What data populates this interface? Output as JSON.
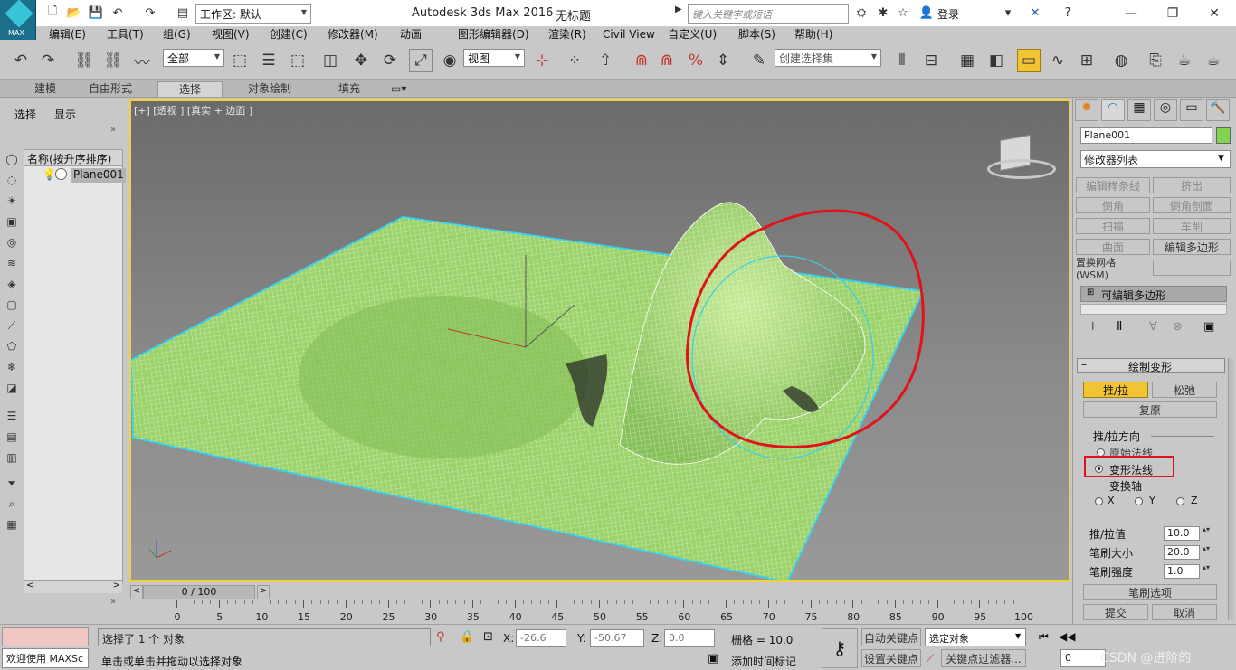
{
  "app": {
    "title": "Autodesk 3ds Max 2016",
    "document": "无标题",
    "workspace": "工作区: 默认",
    "search_placeholder": "键入关键字或短语",
    "login": "登录",
    "logo_text": "MAX"
  },
  "menu": [
    "编辑(E)",
    "工具(T)",
    "组(G)",
    "视图(V)",
    "创建(C)",
    "修改器(M)",
    "动画",
    "图形编辑器(D)",
    "渲染(R)",
    "Civil View",
    "自定义(U)",
    "脚本(S)",
    "帮助(H)"
  ],
  "toolbar": {
    "filter": "全部",
    "ref_coord": "视图",
    "selection_set": "创建选择集"
  },
  "ribbon": [
    "建模",
    "自由形式",
    "选择",
    "对象绘制",
    "填充"
  ],
  "scene": {
    "tabs": [
      "选择",
      "显示"
    ],
    "column": "名称(按升序排序)",
    "object": "Plane001"
  },
  "viewport": {
    "label": "[+] [透视 ] [真实 + 边面 ]"
  },
  "timeline": {
    "frame": "0 / 100",
    "ticks": [
      "0",
      "5",
      "10",
      "15",
      "20",
      "25",
      "30",
      "35",
      "40",
      "45",
      "50",
      "55",
      "60",
      "65",
      "70",
      "75",
      "80",
      "85",
      "90",
      "95",
      "100"
    ]
  },
  "panel": {
    "object_name": "Plane001",
    "object_color": "#7fd34e",
    "modifier_list": "修改器列表",
    "buttons": [
      [
        "编辑样条线",
        "挤出"
      ],
      [
        "倒角",
        "倒角剖面"
      ],
      [
        "扫描",
        "车削"
      ],
      [
        "曲面",
        "编辑多边形"
      ]
    ],
    "wsm": "置换网格 (WSM)",
    "stack_item": "可编辑多边形",
    "rollout": "绘制变形",
    "push_pull": "推/拉",
    "relax": "松弛",
    "revert": "复原",
    "direction_group": "推/拉方向",
    "dir_options": [
      "原始法线",
      "变形法线",
      "变换轴"
    ],
    "axis": [
      "X",
      "Y",
      "Z"
    ],
    "push_value_label": "推/拉值",
    "push_value": "10.0",
    "brush_size_label": "笔刷大小",
    "brush_size": "20.0",
    "brush_strength_label": "笔刷强度",
    "brush_strength": "1.0",
    "brush_options": "笔刷选项",
    "commit": "提交",
    "cancel": "取消"
  },
  "status": {
    "maxscript": "欢迎使用 MAXSc",
    "selected": "选择了 1 个 对象",
    "prompt": "单击或单击并拖动以选择对象",
    "x_label": "X:",
    "x": "-26.6",
    "y_label": "Y:",
    "y": "-50.67",
    "z_label": "Z:",
    "z": "0.0",
    "grid": "栅格 = 10.0",
    "auto_key": "自动关键点",
    "set_key": "设置关键点",
    "selected_obj": "选定对象",
    "key_filters": "关键点过滤器...",
    "add_time_tag": "添加时间标记",
    "frame": "0",
    "watermark": "CSDN @进阶的"
  },
  "colors": {
    "highlight": "#f2c434",
    "annotation": "#e0131b",
    "mesh_fill": "#9cd26a",
    "mesh_line": "#ffffff",
    "selection_edge": "#38d0e8"
  }
}
